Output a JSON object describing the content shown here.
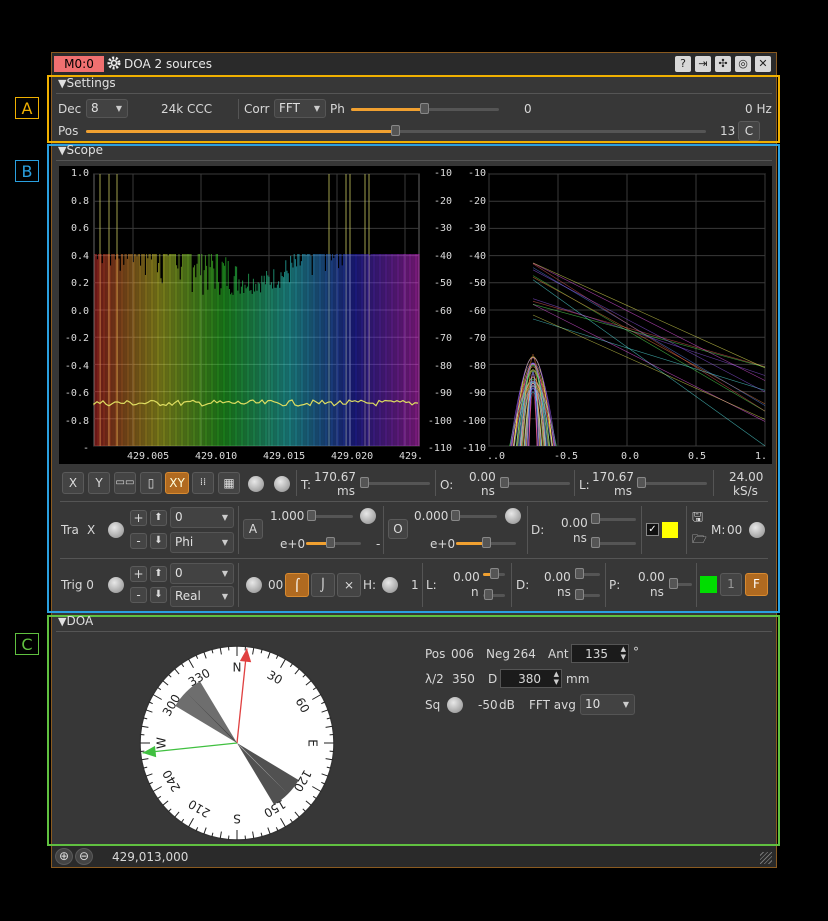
{
  "window": {
    "badge": "M0:0",
    "title": "DOA 2 sources",
    "icons": [
      "help-icon",
      "export-icon",
      "maximize-icon",
      "hide-icon",
      "close-icon"
    ]
  },
  "annotations": {
    "a": "A",
    "b": "B",
    "c": "C",
    "colors": {
      "a": "#f0b000",
      "b": "#2aa0e0",
      "c": "#60c040"
    }
  },
  "settings": {
    "header": "Settings",
    "dec_label": "Dec",
    "dec_value": "8",
    "rate_text": "24k CCC",
    "corr_label": "Corr",
    "corr_value": "FFT",
    "ph_label": "Ph",
    "ph_value": "0",
    "freq_text": "0 Hz",
    "pos_label": "Pos",
    "pos_value": "13",
    "pos_button": "C",
    "ph_fraction": 0.5,
    "pos_fraction": 0.5
  },
  "scope": {
    "header": "Scope",
    "left_y_ticks": [
      "1.0",
      "0.8",
      "0.6",
      "0.4",
      "0.2",
      "0.0",
      "-0.2",
      "-0.4",
      "-0.6",
      "-0.8",
      "-"
    ],
    "left_x_ticks": [
      "429.005",
      "429.010",
      "429.015",
      "429.020",
      "429."
    ],
    "right_y_ticks_a": [
      "-10",
      "-20",
      "-30",
      "-40",
      "-50",
      "-60",
      "-70",
      "-80",
      "-90",
      "-100",
      "-110"
    ],
    "right_y_ticks_b": [
      "-10",
      "-20",
      "-30",
      "-40",
      "-50",
      "-60",
      "-70",
      "-80",
      "-90",
      "-100",
      "-110"
    ],
    "right_x_ticks": [
      "..0",
      "-0.5",
      "0.0",
      "0.5",
      "1."
    ],
    "toolbar": {
      "x": "X",
      "y": "Y",
      "xy": "XY",
      "t_label": "T:",
      "t_value": "170.67",
      "t_unit": "ms",
      "o_label": "O:",
      "o_value": "0.00",
      "o_unit": "ns",
      "l_label": "L:",
      "l_value": "170.67",
      "l_unit": "ms",
      "rate_value": "24.00",
      "rate_unit": "kS/s"
    },
    "trace": {
      "label": "Tra",
      "axis": "X",
      "index": "0",
      "proj": "Phi",
      "a_btn": "A",
      "amp": "1.000",
      "amp_exp": "e+0",
      "dash": "-",
      "o_btn": "O",
      "ofs": "0.000",
      "ofs_exp": "e+0",
      "d_label": "D:",
      "d_value": "0.00",
      "d_unit": "ns",
      "m_label": "M:",
      "m_value": "00",
      "color": "#ffff00"
    },
    "trigger": {
      "label": "Trig 0",
      "index": "0",
      "proj": "Real",
      "count": "00",
      "h_label": "H:",
      "h_value": "1",
      "l_label": "L:",
      "l_value": "0.00",
      "l_unit": "n",
      "d_label": "D:",
      "d_value": "0.00",
      "d_unit": "ns",
      "p_label": "P:",
      "p_value": "0.00",
      "p_unit": "ns",
      "one_btn": "1",
      "f_btn": "F",
      "color": "#00dd00"
    }
  },
  "doa": {
    "header": "DOA",
    "compass_labels": {
      "n": "N",
      "e": "E",
      "s": "S",
      "w": "W",
      "d30": "30",
      "d60": "60",
      "d120": "120",
      "d150": "150",
      "d210": "210",
      "d240": "240",
      "d300": "300",
      "d330": "330"
    },
    "pos_label": "Pos",
    "pos_value": "006",
    "neg_label": "Neg",
    "neg_value": "264",
    "ant_label": "Ant",
    "ant_value": "135",
    "ant_unit": "°",
    "half_lambda_label": "λ/2",
    "half_lambda_value": "350",
    "d_label": "D",
    "d_value": "380",
    "d_unit": "mm",
    "sq_label": "Sq",
    "sq_value": "-50",
    "sq_unit": "dB",
    "fft_avg_label": "FFT avg",
    "fft_avg_value": "10",
    "pos_bearing_deg": 6,
    "neg_bearing_deg": 264,
    "ant_deg": 135
  },
  "status": {
    "frequency": "429,013,000"
  }
}
